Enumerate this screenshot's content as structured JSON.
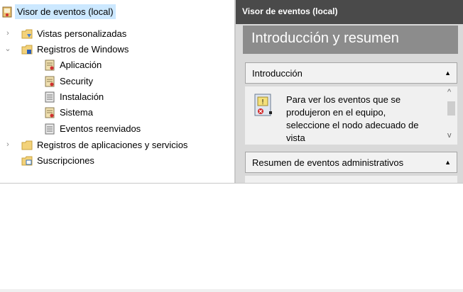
{
  "tree": {
    "root": {
      "label": "Visor de eventos (local)",
      "icon": "event-viewer-icon"
    },
    "items": [
      {
        "label": "Vistas personalizadas",
        "expander": "›",
        "icon": "custom-views-folder-icon"
      },
      {
        "label": "Registros de Windows",
        "expander": "⌄",
        "icon": "windows-logs-folder-icon"
      },
      {
        "label": "Aplicación",
        "icon": "log-icon"
      },
      {
        "label": "Security",
        "icon": "log-icon"
      },
      {
        "label": "Instalación",
        "icon": "log-plain-icon"
      },
      {
        "label": "Sistema",
        "icon": "log-icon"
      },
      {
        "label": "Eventos reenviados",
        "icon": "log-plain-icon"
      },
      {
        "label": "Registros de aplicaciones y servicios",
        "expander": "›",
        "icon": "folder-icon"
      },
      {
        "label": "Suscripciones",
        "icon": "subscriptions-icon"
      }
    ]
  },
  "right": {
    "title": "Visor de eventos (local)",
    "hero": "Introducción y resumen",
    "section1": {
      "title": "Introducción",
      "caret": "▲",
      "body": "Para ver los eventos que se produjeron en el equipo, seleccione el nodo adecuado de vista"
    },
    "section2": {
      "title": "Resumen de eventos administrativos",
      "caret": "▲"
    },
    "scroll": {
      "up": "^",
      "down": "v"
    }
  },
  "colors": {
    "title_bar": "#4a4a4a",
    "hero": "#8c8c8c",
    "selection": "#cce8ff",
    "panel": "#d9d9d9"
  }
}
